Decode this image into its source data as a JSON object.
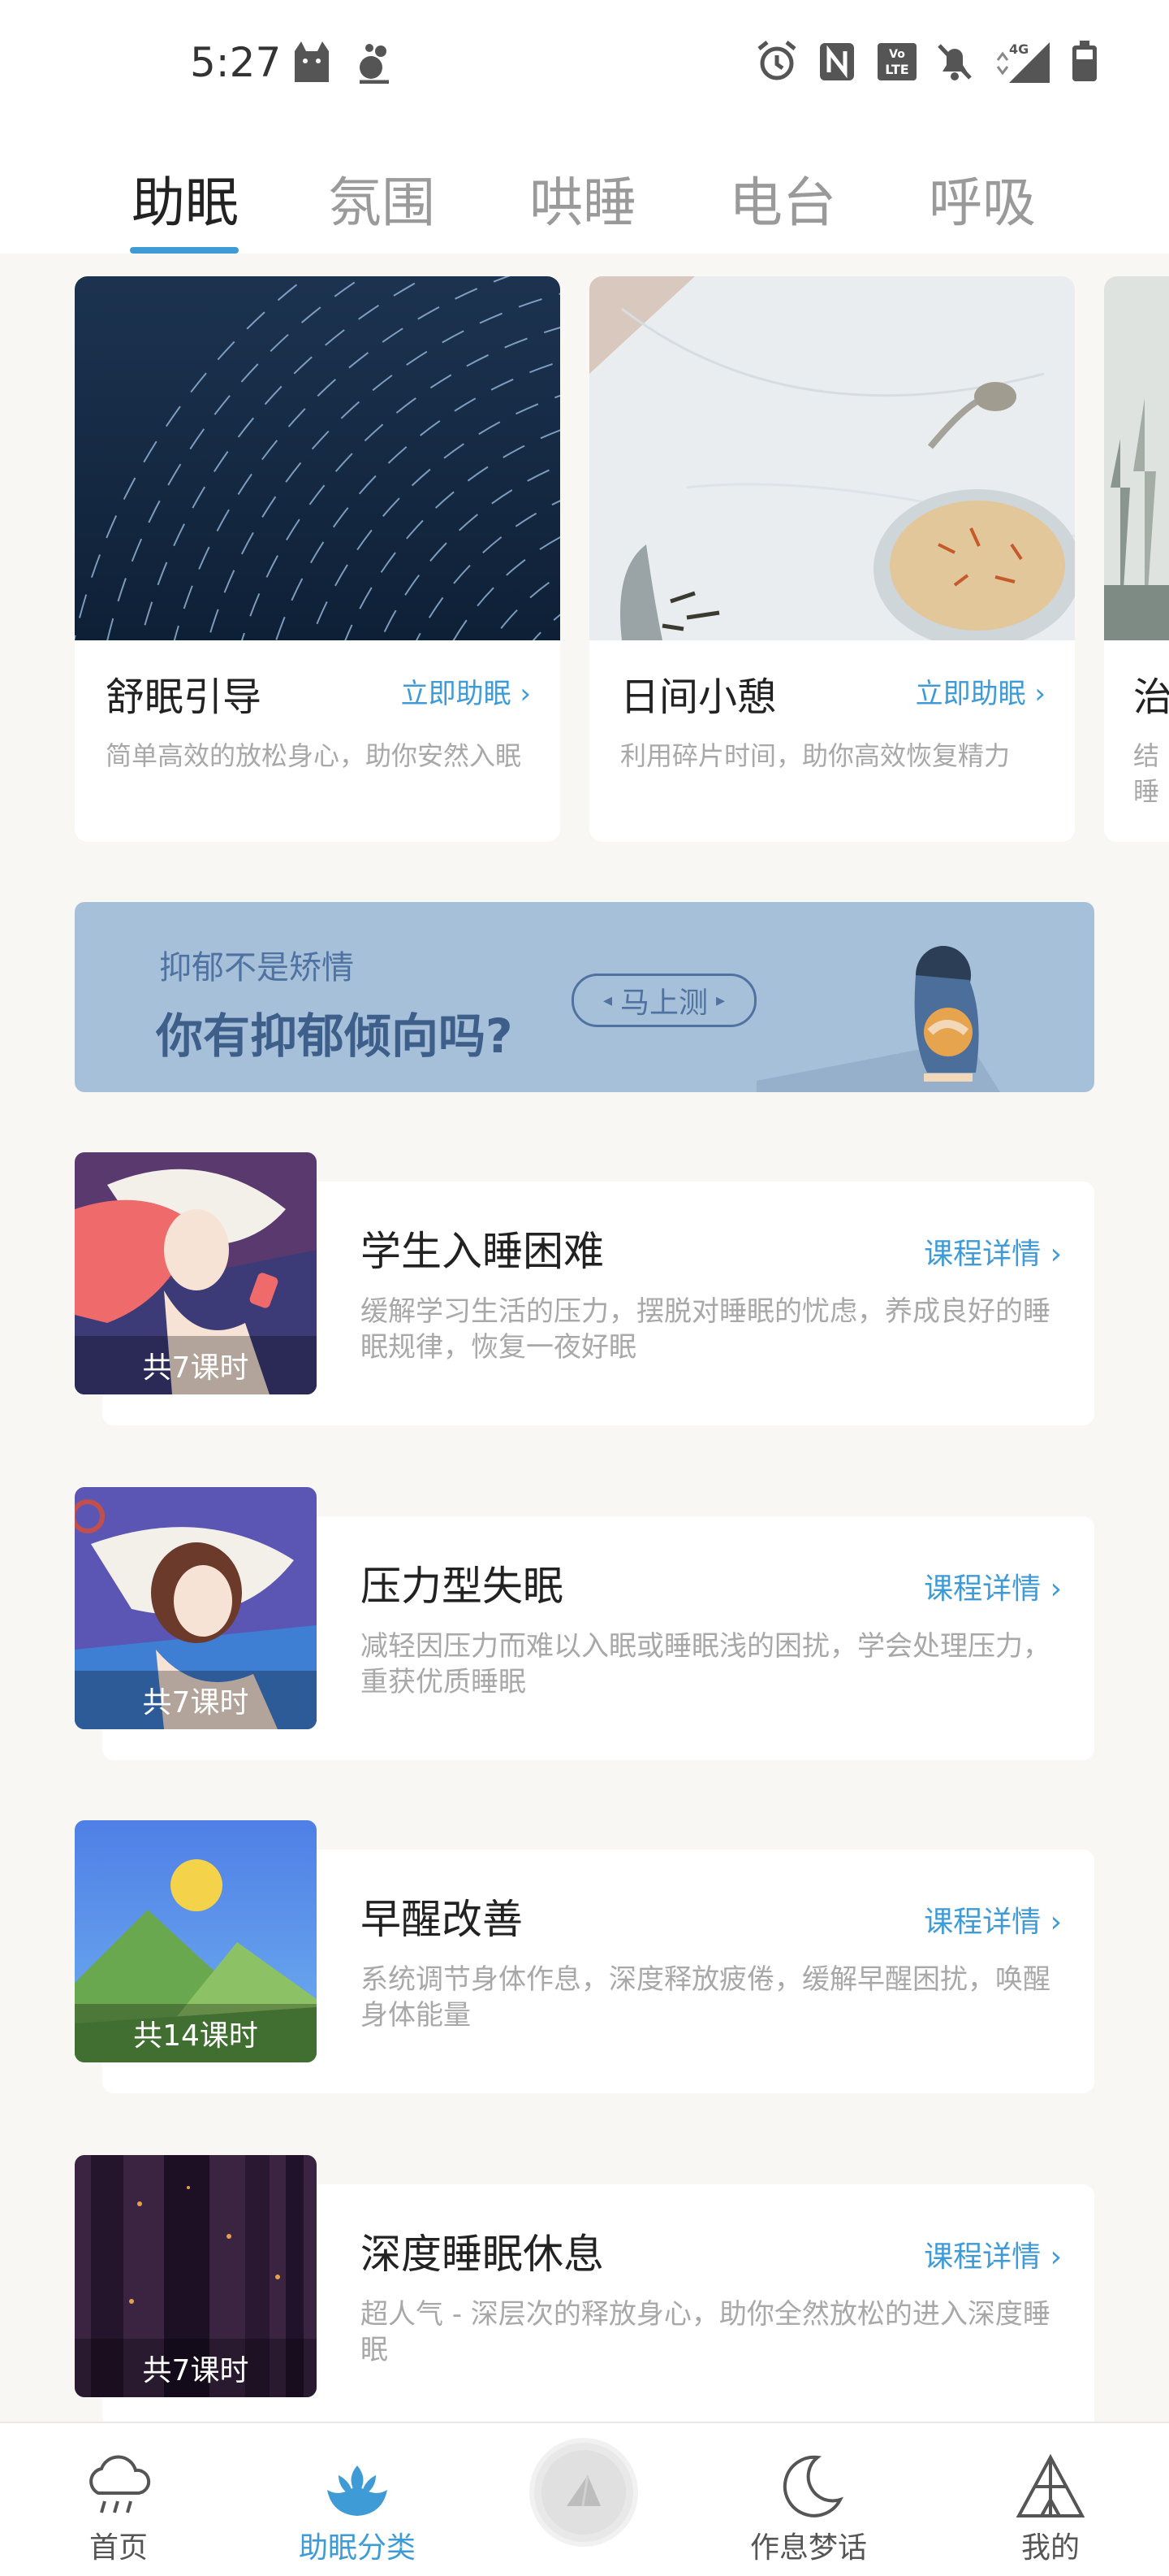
{
  "status": {
    "time": "5:27",
    "icons": [
      "cat-notification-icon",
      "mascot-notification-icon",
      "alarm-icon",
      "nfc-icon",
      "volte-icon",
      "mute-icon",
      "signal-4g-icon",
      "battery-icon"
    ],
    "lte_label": "LTE",
    "net_label": "4G"
  },
  "tabs": [
    {
      "label": "助眠",
      "active": true
    },
    {
      "label": "氛围",
      "active": false
    },
    {
      "label": "哄睡",
      "active": false
    },
    {
      "label": "电台",
      "active": false
    },
    {
      "label": "呼吸",
      "active": false
    }
  ],
  "cards": [
    {
      "title": "舒眠引导",
      "link": "立即助眠 ›",
      "desc": "简单高效的放松身心，助你安然入眠"
    },
    {
      "title": "日间小憩",
      "link": "立即助眠 ›",
      "desc": "利用碎片时间，助你高效恢复精力"
    },
    {
      "title": "治",
      "desc": "结 睡"
    }
  ],
  "banner": {
    "subtitle": "抑郁不是矫情",
    "title": "你有抑郁倾向吗?",
    "button": "马上测"
  },
  "courses": [
    {
      "title": "学生入睡困难",
      "link": "课程详情 ›",
      "lessons": "共7课时",
      "desc": "缓解学习生活的压力，摆脱对睡眠的忧虑，养成良好的睡眠规律，恢复一夜好眠"
    },
    {
      "title": "压力型失眠",
      "link": "课程详情 ›",
      "lessons": "共7课时",
      "desc": "减轻因压力而难以入眠或睡眠浅的困扰，学会处理压力，重获优质睡眠"
    },
    {
      "title": "早醒改善",
      "link": "课程详情 ›",
      "lessons": "共14课时",
      "desc": "系统调节身体作息，深度释放疲倦，缓解早醒困扰，唤醒身体能量"
    },
    {
      "title": "深度睡眠休息",
      "link": "课程详情 ›",
      "lessons": "共7课时",
      "desc": "超人气 - 深层次的释放身心，助你全然放松的进入深度睡眠"
    }
  ],
  "nav": [
    {
      "label": "首页",
      "icon": "cloud-rain-icon",
      "active": false
    },
    {
      "label": "助眠分类",
      "icon": "lotus-icon",
      "active": true
    },
    {
      "label": "",
      "icon": "play-orb-icon",
      "active": false
    },
    {
      "label": "作息梦话",
      "icon": "moon-icon",
      "active": false
    },
    {
      "label": "我的",
      "icon": "tent-icon",
      "active": false
    }
  ],
  "colors": {
    "accent": "#3f9bd6",
    "background": "#f8f7f3",
    "banner": "#a7c0da",
    "banner_text": "#3f5f8b"
  }
}
